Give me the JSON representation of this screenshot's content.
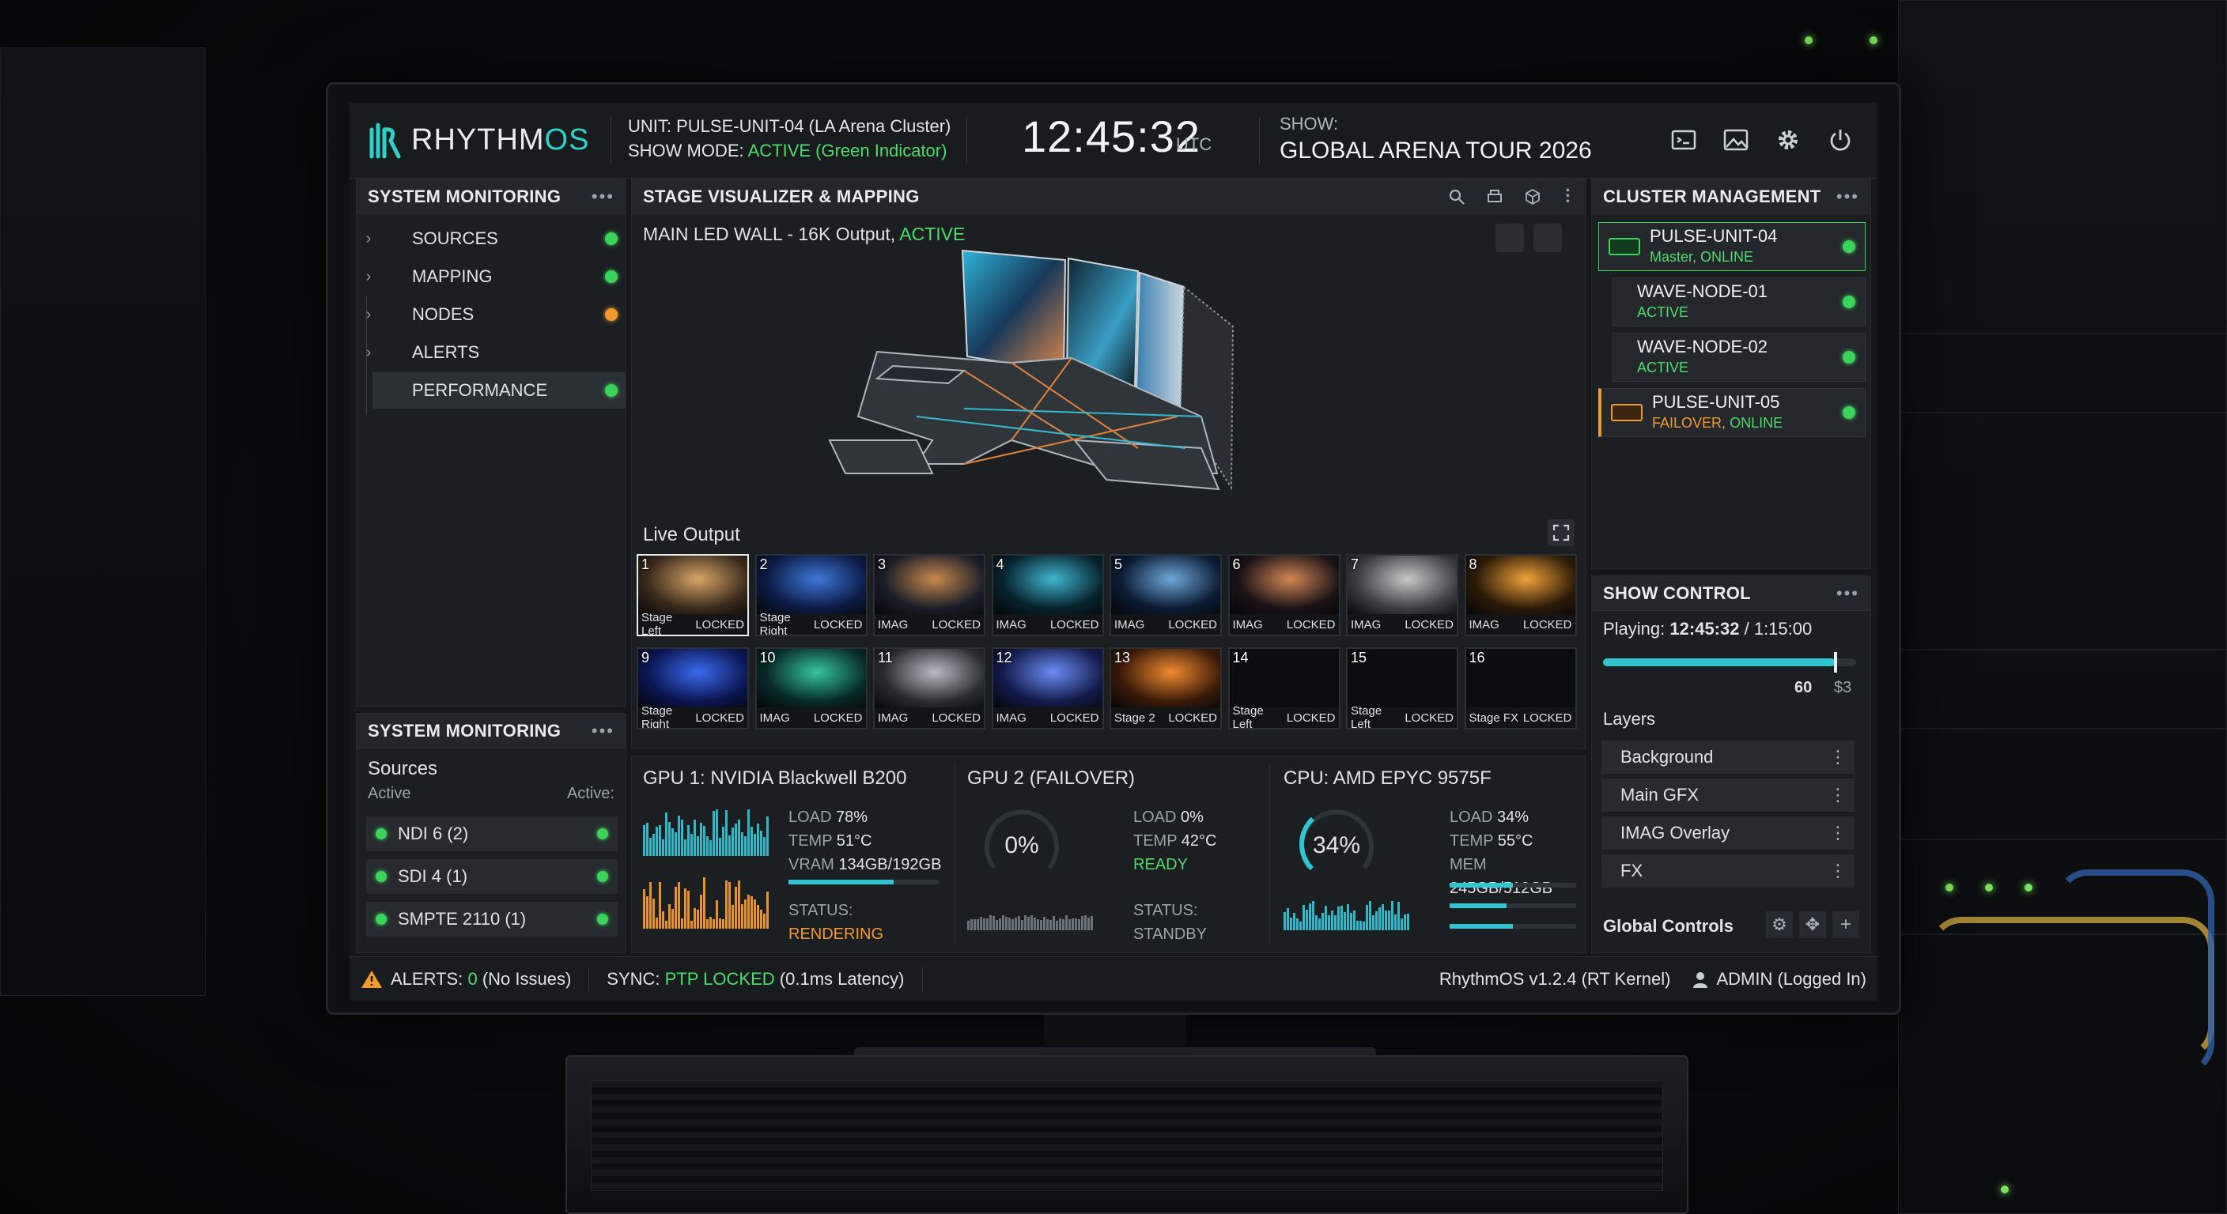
{
  "app": {
    "logo_text_a": "RHYTHM",
    "logo_text_b": "OS"
  },
  "header": {
    "unit_label": "UNIT:",
    "unit_value": "PULSE-UNIT-04 (LA Arena Cluster)",
    "mode_label": "SHOW MODE:",
    "mode_value": "ACTIVE (Green Indicator)",
    "clock": "12:45:32",
    "tz": "UTC",
    "show_label": "SHOW:",
    "show_value": "GLOBAL ARENA TOUR 2026",
    "icons": [
      "terminal-icon",
      "image-icon",
      "gear-icon",
      "power-icon"
    ]
  },
  "system_monitoring": {
    "title": "SYSTEM MONITORING",
    "items": [
      {
        "label": "SOURCES",
        "icon": "sliders-icon",
        "status": "ok"
      },
      {
        "label": "MAPPING",
        "icon": "projector-icon",
        "status": "ok"
      },
      {
        "label": "NODES",
        "icon": "network-icon",
        "status": "warn"
      },
      {
        "label": "ALERTS",
        "icon": "alert-icon",
        "status": "alert"
      },
      {
        "label": "PERFORMANCE",
        "icon": "chart-icon",
        "status": "ok"
      }
    ]
  },
  "sources_panel": {
    "title": "SYSTEM MONITORING",
    "heading": "Sources",
    "active_left": "Active",
    "active_right": "Active:",
    "items": [
      {
        "label": "NDI 6 (2)"
      },
      {
        "label": "SDI 4 (1)"
      },
      {
        "label": "SMPTE 2110 (1)"
      }
    ]
  },
  "stage": {
    "title": "STAGE VISUALIZER & MAPPING",
    "output_label": "MAIN LED WALL - 16K Output,",
    "output_state": "ACTIVE",
    "live_output": "Live Output",
    "thumbs": [
      {
        "num": "1",
        "label": "Stage Left",
        "state": "LOCKED",
        "c1": "#3a2a1c",
        "c2": "#d9a567"
      },
      {
        "num": "2",
        "label": "Stage Right",
        "state": "LOCKED",
        "c1": "#0c1a44",
        "c2": "#3d78d8"
      },
      {
        "num": "3",
        "label": "IMAG",
        "state": "LOCKED",
        "c1": "#1b1e28",
        "c2": "#c8894d"
      },
      {
        "num": "4",
        "label": "IMAG",
        "state": "LOCKED",
        "c1": "#06222c",
        "c2": "#3fb6d0"
      },
      {
        "num": "5",
        "label": "IMAG",
        "state": "LOCKED",
        "c1": "#0b1b33",
        "c2": "#6fa7d9"
      },
      {
        "num": "6",
        "label": "IMAG",
        "state": "LOCKED",
        "c1": "#1a1216",
        "c2": "#d28654"
      },
      {
        "num": "7",
        "label": "IMAG",
        "state": "LOCKED",
        "c1": "#3c3d40",
        "c2": "#c8c8c8"
      },
      {
        "num": "8",
        "label": "IMAG",
        "state": "LOCKED",
        "c1": "#2b1a08",
        "c2": "#f0a23a"
      },
      {
        "num": "9",
        "label": "Stage Right",
        "state": "LOCKED",
        "c1": "#0b1550",
        "c2": "#3b6af0"
      },
      {
        "num": "10",
        "label": "IMAG",
        "state": "LOCKED",
        "c1": "#072a26",
        "c2": "#35c4a0"
      },
      {
        "num": "11",
        "label": "IMAG",
        "state": "LOCKED",
        "c1": "#2a2c30",
        "c2": "#b8bcc2"
      },
      {
        "num": "12",
        "label": "IMAG",
        "state": "LOCKED",
        "c1": "#131a4a",
        "c2": "#6b8cf5"
      },
      {
        "num": "13",
        "label": "Stage 2",
        "state": "LOCKED",
        "c1": "#3a1a08",
        "c2": "#f08a30"
      },
      {
        "num": "14",
        "label": "Stage Left",
        "state": "LOCKED",
        "c1": "",
        "c2": ""
      },
      {
        "num": "15",
        "label": "Stage Left",
        "state": "LOCKED",
        "c1": "",
        "c2": ""
      },
      {
        "num": "16",
        "label": "Stage FX",
        "state": "LOCKED",
        "c1": "",
        "c2": ""
      }
    ]
  },
  "stats": {
    "gpu1": {
      "title": "GPU 1: NVIDIA Blackwell B200",
      "load_l": "LOAD",
      "load": "78%",
      "temp_l": "TEMP",
      "temp": "51°C",
      "vram_l": "VRAM",
      "vram": "134GB/192GB",
      "vram_frac": 0.7,
      "status_l": "STATUS:",
      "status": "RENDERING"
    },
    "gpu2": {
      "title": "GPU 2 (FAILOVER)",
      "gauge": "0%",
      "load_l": "LOAD",
      "load": "0%",
      "temp_l": "TEMP",
      "temp": "42°C",
      "ready": "READY",
      "status_l": "STATUS:",
      "status": "STANDBY"
    },
    "cpu": {
      "title": "CPU: AMD EPYC 9575F",
      "gauge": "34%",
      "gauge_frac": 0.34,
      "load_l": "LOAD",
      "load": "34%",
      "temp_l": "TEMP",
      "temp": "55°C",
      "mem_l": "MEM",
      "mem": "245GB/512GB",
      "bars": [
        0.5,
        0.45,
        0.5
      ]
    }
  },
  "cluster": {
    "title": "CLUSTER MANAGEMENT",
    "nodes": [
      {
        "name": "PULSE-UNIT-04",
        "badge": "ONLINE",
        "sub_a": "Master, ONLINE",
        "sub_b": ""
      },
      {
        "name": "WAVE-NODE-01",
        "badge": "",
        "sub_a": "ACTIVE",
        "sub_b": ""
      },
      {
        "name": "WAVE-NODE-02",
        "badge": "",
        "sub_a": "ACTIVE",
        "sub_b": ""
      },
      {
        "name": "PULSE-UNIT-05",
        "badge": "FAILOVER",
        "sub_a": "FAILOVER,",
        "sub_b": "ONLINE"
      }
    ]
  },
  "show_control": {
    "title": "SHOW CONTROL",
    "playing_label": "Playing:",
    "playing_time": "12:45:32",
    "duration": "/ 1:15:00",
    "progress": 0.92,
    "val_a": "60",
    "val_b": "$3",
    "layers_label": "Layers",
    "layers": [
      {
        "label": "Background",
        "color": "#4aa0d8"
      },
      {
        "label": "Main GFX",
        "color": "#d8923a"
      },
      {
        "label": "IMAG Overlay",
        "color": "#2a2e33"
      },
      {
        "label": "FX",
        "color": "#2a2e33"
      }
    ],
    "global_controls": "Global Controls"
  },
  "status_bar": {
    "alerts_label": "ALERTS:",
    "alerts_count": "0",
    "alerts_note": "(No Issues)",
    "sync_label": "SYNC:",
    "sync_value": "PTP LOCKED",
    "sync_note": "(0.1ms Latency)",
    "version": "RhythmOS v1.2.4 (RT Kernel)",
    "user": "ADMIN (Logged In)"
  }
}
